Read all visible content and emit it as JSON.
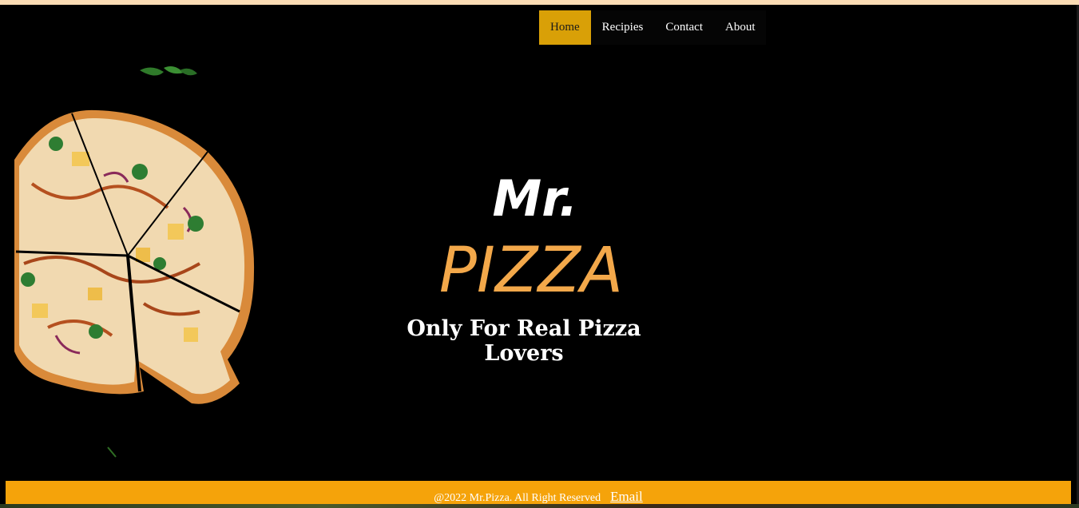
{
  "nav": {
    "items": [
      {
        "label": "Home",
        "active": true
      },
      {
        "label": "Recipies",
        "active": false
      },
      {
        "label": "Contact",
        "active": false
      },
      {
        "label": "About",
        "active": false
      }
    ]
  },
  "hero": {
    "logo_line1": "Mr.",
    "logo_line2": "PIZZA",
    "tagline": "Only For Real Pizza Lovers"
  },
  "footer": {
    "copyright": "@2022 Mr.Pizza. All Right Reserved",
    "email_label": "Email"
  },
  "colors": {
    "accent": "#d9a007",
    "footer_bg": "#f5a30a",
    "logo_orange": "#f3a84a",
    "background": "#000000"
  }
}
